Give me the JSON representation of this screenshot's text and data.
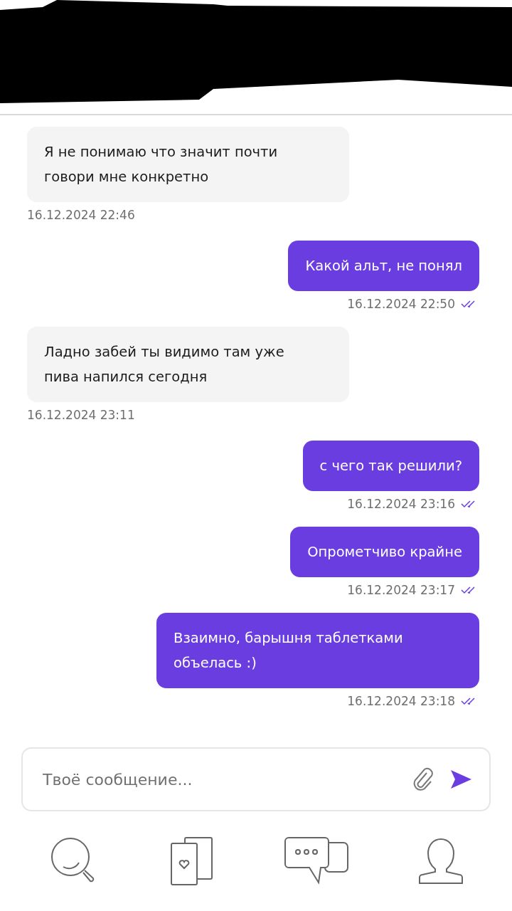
{
  "messages": [
    {
      "kind": "incoming",
      "text": "Я не понимаю что значит почти говори мне конкретно",
      "time": "16.12.2024 22:46"
    },
    {
      "kind": "outgoing",
      "text": "Какой альт, не понял",
      "time": "16.12.2024 22:50"
    },
    {
      "kind": "incoming",
      "text": "Ладно забей ты видимо там уже пива напился сегодня",
      "time": "16.12.2024 23:11"
    },
    {
      "kind": "outgoing",
      "text": "с чего так решили?",
      "time": "16.12.2024 23:16"
    },
    {
      "kind": "outgoing",
      "text": "Опрометчиво крайне",
      "time": "16.12.2024 23:17"
    },
    {
      "kind": "outgoing",
      "text": "Взаимно, барышня таблетками объелась :)",
      "time": "16.12.2024 23:18"
    }
  ],
  "composer": {
    "placeholder": "Твоё сообщение..."
  }
}
